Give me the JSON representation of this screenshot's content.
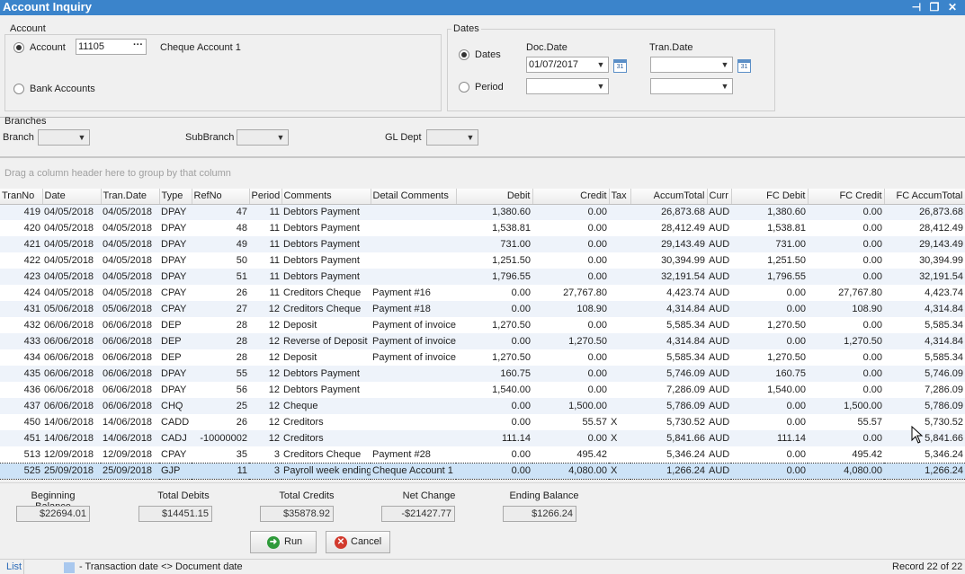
{
  "window": {
    "title": "Account Inquiry"
  },
  "account_group": {
    "title": "Account",
    "account_label": "Account",
    "account_value": "11105",
    "ellipsis": "···",
    "account_name": "Cheque Account 1",
    "bank_accounts_label": "Bank Accounts"
  },
  "dates_group": {
    "title": "Dates",
    "dates_label": "Dates",
    "period_label": "Period",
    "doc_date_label": "Doc.Date",
    "doc_date_value": "01/07/2017",
    "tran_date_label": "Tran.Date",
    "tran_date_value": "",
    "period_from_value": "",
    "period_to_value": "",
    "calendar_text": "31"
  },
  "branches": {
    "title": "Branches",
    "branch_label": "Branch",
    "subbranch_label": "SubBranch",
    "gldept_label": "GL Dept"
  },
  "group_hint": "Drag a column header here to group by that column",
  "columns": [
    "TranNo",
    "Date",
    "Tran.Date",
    "Type",
    "RefNo",
    "Period",
    "Comments",
    "Detail Comments",
    "Debit",
    "Credit",
    "Tax",
    "AccumTotal",
    "Curr",
    "FC Debit",
    "FC Credit",
    "FC AccumTotal"
  ],
  "rows": [
    [
      "419",
      "04/05/2018",
      "04/05/2018",
      "DPAY",
      "47",
      "11",
      "Debtors Payment",
      "",
      "1,380.60",
      "0.00",
      "",
      "26,873.68",
      "AUD",
      "1,380.60",
      "0.00",
      "26,873.68"
    ],
    [
      "420",
      "04/05/2018",
      "04/05/2018",
      "DPAY",
      "48",
      "11",
      "Debtors Payment",
      "",
      "1,538.81",
      "0.00",
      "",
      "28,412.49",
      "AUD",
      "1,538.81",
      "0.00",
      "28,412.49"
    ],
    [
      "421",
      "04/05/2018",
      "04/05/2018",
      "DPAY",
      "49",
      "11",
      "Debtors Payment",
      "",
      "731.00",
      "0.00",
      "",
      "29,143.49",
      "AUD",
      "731.00",
      "0.00",
      "29,143.49"
    ],
    [
      "422",
      "04/05/2018",
      "04/05/2018",
      "DPAY",
      "50",
      "11",
      "Debtors Payment",
      "",
      "1,251.50",
      "0.00",
      "",
      "30,394.99",
      "AUD",
      "1,251.50",
      "0.00",
      "30,394.99"
    ],
    [
      "423",
      "04/05/2018",
      "04/05/2018",
      "DPAY",
      "51",
      "11",
      "Debtors Payment",
      "",
      "1,796.55",
      "0.00",
      "",
      "32,191.54",
      "AUD",
      "1,796.55",
      "0.00",
      "32,191.54"
    ],
    [
      "424",
      "04/05/2018",
      "04/05/2018",
      "CPAY",
      "26",
      "11",
      "Creditors Cheque",
      "Payment #16",
      "0.00",
      "27,767.80",
      "",
      "4,423.74",
      "AUD",
      "0.00",
      "27,767.80",
      "4,423.74"
    ],
    [
      "431",
      "05/06/2018",
      "05/06/2018",
      "CPAY",
      "27",
      "12",
      "Creditors Cheque",
      "Payment #18",
      "0.00",
      "108.90",
      "",
      "4,314.84",
      "AUD",
      "0.00",
      "108.90",
      "4,314.84"
    ],
    [
      "432",
      "06/06/2018",
      "06/06/2018",
      "DEP",
      "28",
      "12",
      "Deposit",
      "Payment of invoice",
      "1,270.50",
      "0.00",
      "",
      "5,585.34",
      "AUD",
      "1,270.50",
      "0.00",
      "5,585.34"
    ],
    [
      "433",
      "06/06/2018",
      "06/06/2018",
      "DEP",
      "28",
      "12",
      "Reverse of Deposit",
      "Payment of invoice",
      "0.00",
      "1,270.50",
      "",
      "4,314.84",
      "AUD",
      "0.00",
      "1,270.50",
      "4,314.84"
    ],
    [
      "434",
      "06/06/2018",
      "06/06/2018",
      "DEP",
      "28",
      "12",
      "Deposit",
      "Payment of invoice",
      "1,270.50",
      "0.00",
      "",
      "5,585.34",
      "AUD",
      "1,270.50",
      "0.00",
      "5,585.34"
    ],
    [
      "435",
      "06/06/2018",
      "06/06/2018",
      "DPAY",
      "55",
      "12",
      "Debtors Payment",
      "",
      "160.75",
      "0.00",
      "",
      "5,746.09",
      "AUD",
      "160.75",
      "0.00",
      "5,746.09"
    ],
    [
      "436",
      "06/06/2018",
      "06/06/2018",
      "DPAY",
      "56",
      "12",
      "Debtors Payment",
      "",
      "1,540.00",
      "0.00",
      "",
      "7,286.09",
      "AUD",
      "1,540.00",
      "0.00",
      "7,286.09"
    ],
    [
      "437",
      "06/06/2018",
      "06/06/2018",
      "CHQ",
      "25",
      "12",
      "Cheque",
      "",
      "0.00",
      "1,500.00",
      "",
      "5,786.09",
      "AUD",
      "0.00",
      "1,500.00",
      "5,786.09"
    ],
    [
      "450",
      "14/06/2018",
      "14/06/2018",
      "CADD",
      "26",
      "12",
      "Creditors",
      "",
      "0.00",
      "55.57",
      "X",
      "5,730.52",
      "AUD",
      "0.00",
      "55.57",
      "5,730.52"
    ],
    [
      "451",
      "14/06/2018",
      "14/06/2018",
      "CADJ",
      "-10000002",
      "12",
      "Creditors",
      "",
      "111.14",
      "0.00",
      "X",
      "5,841.66",
      "AUD",
      "111.14",
      "0.00",
      "5,841.66"
    ],
    [
      "513",
      "12/09/2018",
      "12/09/2018",
      "CPAY",
      "35",
      "3",
      "Creditors Cheque",
      "Payment #28",
      "0.00",
      "495.42",
      "",
      "5,346.24",
      "AUD",
      "0.00",
      "495.42",
      "5,346.24"
    ],
    [
      "525",
      "25/09/2018",
      "25/09/2018",
      "GJP",
      "11",
      "3",
      "Payroll week ending",
      "Cheque Account 1",
      "0.00",
      "4,080.00",
      "X",
      "1,266.24",
      "AUD",
      "0.00",
      "4,080.00",
      "1,266.24"
    ]
  ],
  "summary": {
    "beginning_label": "Beginning Balance",
    "beginning_value": "$22694.01",
    "debits_label": "Total Debits",
    "debits_value": "$14451.15",
    "credits_label": "Total Credits",
    "credits_value": "$35878.92",
    "net_label": "Net Change",
    "net_value": "-$21427.77",
    "ending_label": "Ending Balance",
    "ending_value": "$1266.24"
  },
  "buttons": {
    "run": "Run",
    "cancel": "Cancel"
  },
  "status": {
    "list_label": "List",
    "legend_text": "- Transaction date <> Document date",
    "record_text": "Record 22 of 22"
  },
  "colors": {
    "titlebar": "#3b84cb",
    "selected_row": "#cde3f7",
    "alt_row": "#eef3fa",
    "legend_swatch": "#a9c8ee"
  }
}
